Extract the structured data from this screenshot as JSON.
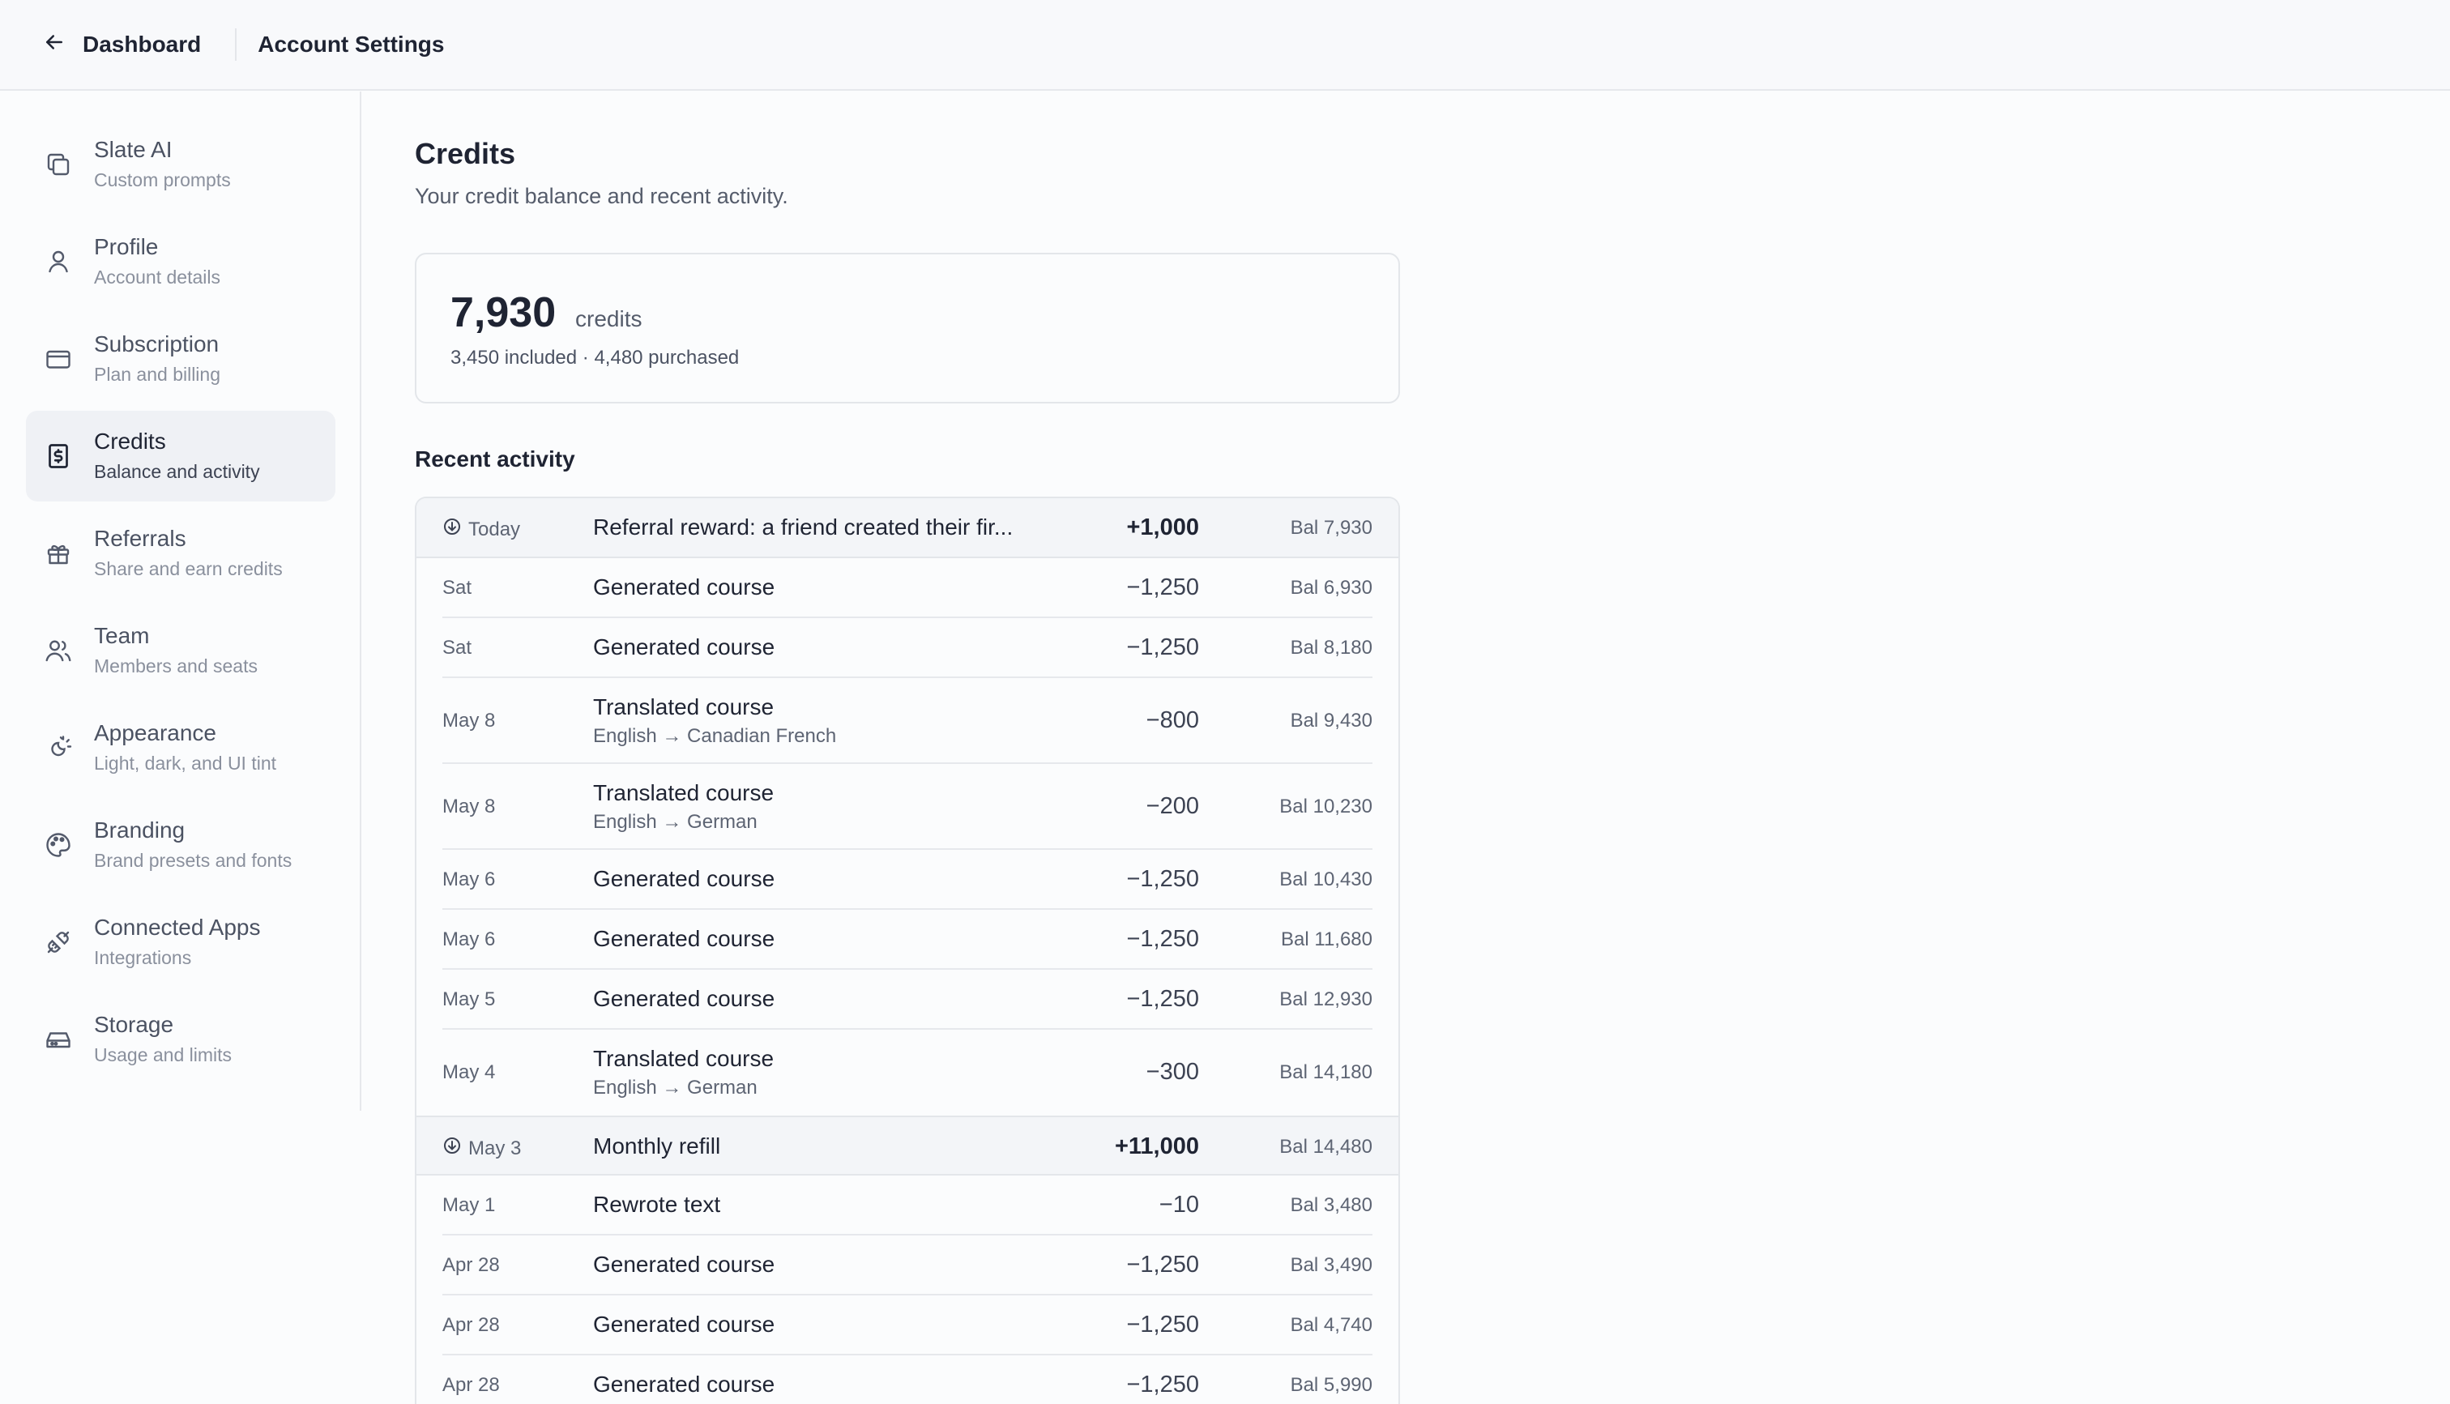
{
  "header": {
    "back_label": "Dashboard",
    "title": "Account Settings"
  },
  "sidebar": {
    "items": [
      {
        "title": "Slate AI",
        "subtitle": "Custom prompts",
        "icon": "copy-icon"
      },
      {
        "title": "Profile",
        "subtitle": "Account details",
        "icon": "user-icon"
      },
      {
        "title": "Subscription",
        "subtitle": "Plan and billing",
        "icon": "credit-card-icon"
      },
      {
        "title": "Credits",
        "subtitle": "Balance and activity",
        "icon": "dollar-receipt-icon",
        "active": true
      },
      {
        "title": "Referrals",
        "subtitle": "Share and earn credits",
        "icon": "gift-icon"
      },
      {
        "title": "Team",
        "subtitle": "Members and seats",
        "icon": "users-icon"
      },
      {
        "title": "Appearance",
        "subtitle": "Light, dark, and UI tint",
        "icon": "sun-moon-icon"
      },
      {
        "title": "Branding",
        "subtitle": "Brand presets and fonts",
        "icon": "palette-icon"
      },
      {
        "title": "Connected Apps",
        "subtitle": "Integrations",
        "icon": "plug-icon"
      },
      {
        "title": "Storage",
        "subtitle": "Usage and limits",
        "icon": "hard-drive-icon"
      }
    ]
  },
  "main": {
    "title": "Credits",
    "subtitle": "Your credit balance and recent activity.",
    "balance": {
      "amount": "7,930",
      "unit": "credits",
      "breakdown": "3,450 included · 4,480 purchased"
    },
    "activity_title": "Recent activity",
    "activity": [
      {
        "date": "Today",
        "desc": "Referral reward: a friend created their fir...",
        "amount": "+1,000",
        "balance": "Bal 7,930",
        "credit": true
      },
      {
        "date": "Sat",
        "desc": "Generated course",
        "amount": "−1,250",
        "balance": "Bal 6,930"
      },
      {
        "date": "Sat",
        "desc": "Generated course",
        "amount": "−1,250",
        "balance": "Bal 8,180"
      },
      {
        "date": "May 8",
        "desc": "Translated course",
        "detail": "English → Canadian French",
        "amount": "−800",
        "balance": "Bal 9,430"
      },
      {
        "date": "May 8",
        "desc": "Translated course",
        "detail": "English → German",
        "amount": "−200",
        "balance": "Bal 10,230"
      },
      {
        "date": "May 6",
        "desc": "Generated course",
        "amount": "−1,250",
        "balance": "Bal 10,430"
      },
      {
        "date": "May 6",
        "desc": "Generated course",
        "amount": "−1,250",
        "balance": "Bal 11,680"
      },
      {
        "date": "May 5",
        "desc": "Generated course",
        "amount": "−1,250",
        "balance": "Bal 12,930"
      },
      {
        "date": "May 4",
        "desc": "Translated course",
        "detail": "English → German",
        "amount": "−300",
        "balance": "Bal 14,180"
      },
      {
        "date": "May 3",
        "desc": "Monthly refill",
        "amount": "+11,000",
        "balance": "Bal 14,480",
        "credit": true
      },
      {
        "date": "May 1",
        "desc": "Rewrote text",
        "amount": "−10",
        "balance": "Bal 3,480"
      },
      {
        "date": "Apr 28",
        "desc": "Generated course",
        "amount": "−1,250",
        "balance": "Bal 3,490"
      },
      {
        "date": "Apr 28",
        "desc": "Generated course",
        "amount": "−1,250",
        "balance": "Bal 4,740"
      },
      {
        "date": "Apr 28",
        "desc": "Generated course",
        "amount": "−1,250",
        "balance": "Bal 5,990"
      }
    ]
  }
}
